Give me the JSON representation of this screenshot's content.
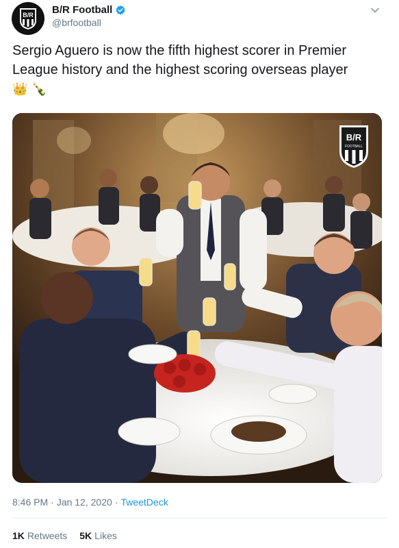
{
  "account": {
    "display_name": "B/R Football",
    "handle": "@brfootball",
    "avatar_text": "B/R",
    "verified": true
  },
  "tweet": {
    "text": "Sergio Aguero is now the fifth highest scorer in Premier League history and the highest scoring overseas player",
    "emojis": [
      "👑",
      "🍾"
    ]
  },
  "media": {
    "logo_text": "B/R",
    "logo_subtext": "FOOTBALL",
    "icon": "photo-of-players-toasting"
  },
  "meta": {
    "time": "8:46 PM",
    "date": "Jan 12, 2020",
    "separator": "·",
    "source": "TweetDeck"
  },
  "stats": {
    "retweets_count": "1K",
    "retweets_label": "Retweets",
    "likes_count": "5K",
    "likes_label": "Likes"
  },
  "colors": {
    "link": "#1b95e0",
    "secondary_text": "#657786",
    "verified": "#1da1f2"
  }
}
